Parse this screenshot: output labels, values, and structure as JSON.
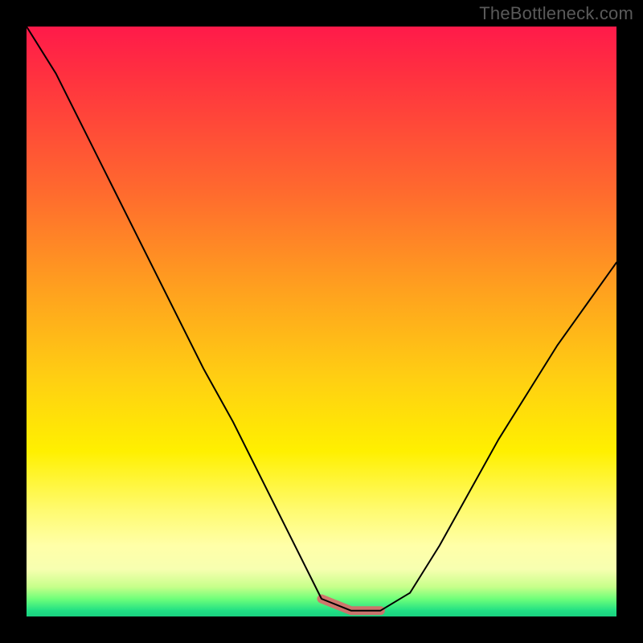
{
  "watermark": "TheBottleneck.com",
  "chart_data": {
    "type": "line",
    "title": "",
    "xlabel": "",
    "ylabel": "",
    "x": [
      0.0,
      0.05,
      0.1,
      0.15,
      0.2,
      0.25,
      0.3,
      0.35,
      0.4,
      0.45,
      0.5,
      0.55,
      0.6,
      0.65,
      0.7,
      0.75,
      0.8,
      0.85,
      0.9,
      0.95,
      1.0
    ],
    "series": [
      {
        "name": "curve",
        "values": [
          100,
          92,
          82,
          72,
          62,
          52,
          42,
          33,
          23,
          13,
          3,
          1,
          1,
          4,
          12,
          21,
          30,
          38,
          46,
          53,
          60
        ]
      }
    ],
    "xlim": [
      0,
      1
    ],
    "ylim": [
      0,
      100
    ],
    "highlight": {
      "x_range": [
        0.47,
        0.62
      ],
      "y_approx": 1,
      "color": "#d96a6a",
      "note": "bottom-of-valley segment drawn thick"
    },
    "background_gradient": {
      "direction": "vertical",
      "stops": [
        "#ff1a4a",
        "#ffa21e",
        "#fff000",
        "#ffffa8",
        "#21e084"
      ]
    },
    "grid": false,
    "legend": false
  }
}
